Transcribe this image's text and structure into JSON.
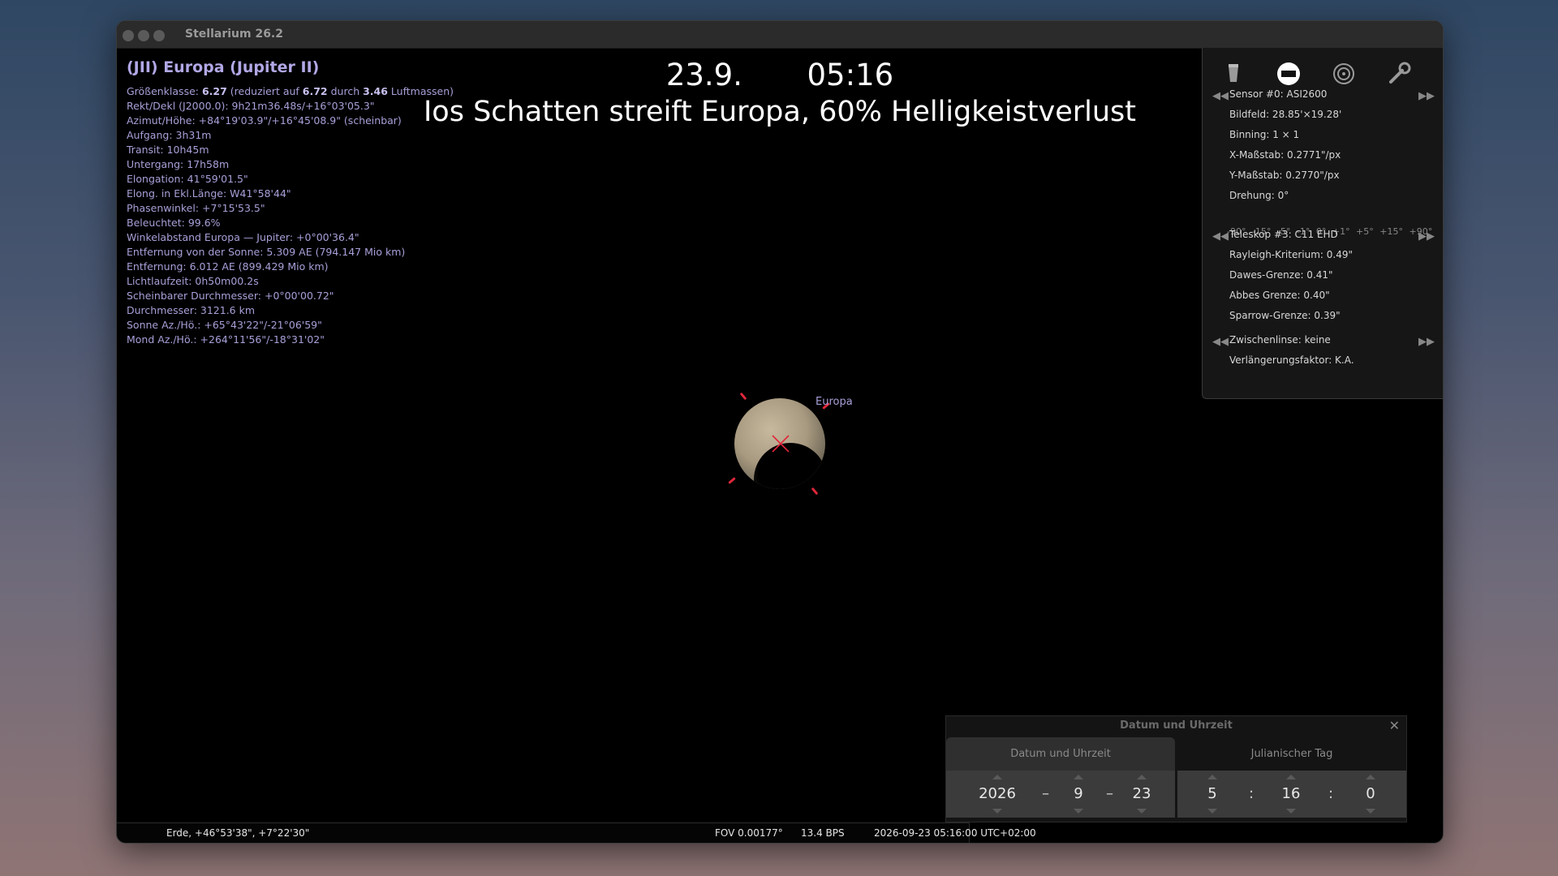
{
  "window": {
    "title": "Stellarium 26.2"
  },
  "info": {
    "title": "(JII) Europa (Jupiter II)",
    "magnitude": {
      "prefix": "Größenklasse: ",
      "value": "6.27",
      "mid1": " (reduziert auf ",
      "reduced": "6.72",
      "mid2": " durch ",
      "airmass": "3.46",
      "suffix": " Luftmassen)"
    },
    "lines": [
      "Rekt/Dekl (J2000.0): 9h21m36.48s/+16°03'05.3\"",
      "Azimut/Höhe: +84°19'03.9\"/+16°45'08.9\" (scheinbar)",
      "Aufgang: 3h31m",
      "Transit: 10h45m",
      "Untergang: 17h58m",
      "Elongation: 41°59'01.5\"",
      "Elong. in Ekl.Länge: W41°58'44\"",
      "Phasenwinkel: +7°15'53.5\"",
      "Beleuchtet: 99.6%",
      "Winkelabstand Europa — Jupiter: +0°00'36.4\"",
      "Entfernung von der Sonne: 5.309 AE (794.147 Mio km)",
      "Entfernung: 6.012 AE (899.429 Mio km)",
      "Lichtlaufzeit: 0h50m00.2s",
      "Scheinbarer Durchmesser: +0°00'00.72\"",
      "Durchmesser: 3121.6 km",
      "Sonne Az./Hö.: +65°43'22\"/-21°06'59\"",
      "Mond Az./Hö.: +264°11'56\"/-18°31'02\""
    ]
  },
  "overlay": {
    "date": "23.9.",
    "time": "05:16",
    "caption": "Ios Schatten streift Europa, 60% Helligkeistverlust"
  },
  "sky": {
    "object_label": "Europa"
  },
  "oculars": {
    "sensor": "Sensor #0: ASI2600",
    "bildfeld": "Bildfeld: 28.85'×19.28'",
    "binning": "Binning: 1 × 1",
    "xscale": "X-Maßstab: 0.2771\"/px",
    "yscale": "Y-Maßstab: 0.2770\"/px",
    "drehung": "Drehung: 0°",
    "rotation_steps": "-90° -15° -5° -1° 0° +1° +5° +15° +90°",
    "telescope": "Teleskop #3: C11 EHD",
    "rayleigh": "Rayleigh-Kriterium: 0.49\"",
    "dawes": "Dawes-Grenze: 0.41\"",
    "abbe": "Abbes Grenze: 0.40\"",
    "sparrow": "Sparrow-Grenze: 0.39\"",
    "lens": "Zwischenlinse: keine",
    "factor": "Verlängerungsfaktor: K.A."
  },
  "datetime_dialog": {
    "title": "Datum und Uhrzeit",
    "tab_date": "Datum und Uhrzeit",
    "tab_jd": "Julianischer Tag",
    "year": "2026",
    "month": "9",
    "day": "23",
    "hour": "5",
    "minute": "16",
    "second": "0",
    "date_sep": "–",
    "time_sep": ":"
  },
  "status": {
    "location": "Erde, +46°53'38\", +7°22'30\"",
    "fov": "FOV 0.00177°",
    "fps": "13.4 BPS",
    "datetime": "2026-09-23 05:16:00 UTC+02:00"
  },
  "colors": {
    "info_text": "#a7a0d8",
    "marker_red": "#e0273a",
    "background_top": "#2f4763",
    "background_bottom": "#8f7474"
  }
}
